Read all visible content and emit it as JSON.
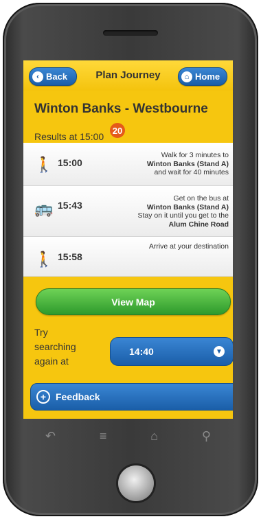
{
  "header": {
    "back_label": "Back",
    "title": "Plan Journey",
    "home_label": "Home"
  },
  "route": {
    "title": "Winton Banks - Westbourne",
    "results_label": "Results at 15:00"
  },
  "steps": [
    {
      "icon": "walk-icon",
      "time": "15:00",
      "line1": "Walk for 3 minutes to",
      "line2": "Winton Banks (Stand A)",
      "line3": "and wait for 40 minutes"
    },
    {
      "icon": "bus-icon",
      "time": "15:43",
      "line1": "Get on the bus at",
      "line2": "Winton Banks (Stand A)",
      "line3": "Stay on it until you get to the",
      "line4": "Alum Chine Road",
      "route_number": "20"
    },
    {
      "icon": "walk-icon",
      "time": "15:58",
      "line1": "Arrive at your destination"
    }
  ],
  "actions": {
    "view_map_label": "View Map",
    "try_line1": "Try",
    "try_line2": "searching",
    "try_line3": "again at",
    "time_value": "14:40",
    "feedback_label": "Feedback"
  },
  "colors": {
    "accent_yellow": "#f6c60f",
    "button_blue": "#1a5ea8",
    "button_green": "#2e9a2c",
    "badge_orange": "#e55a19"
  }
}
